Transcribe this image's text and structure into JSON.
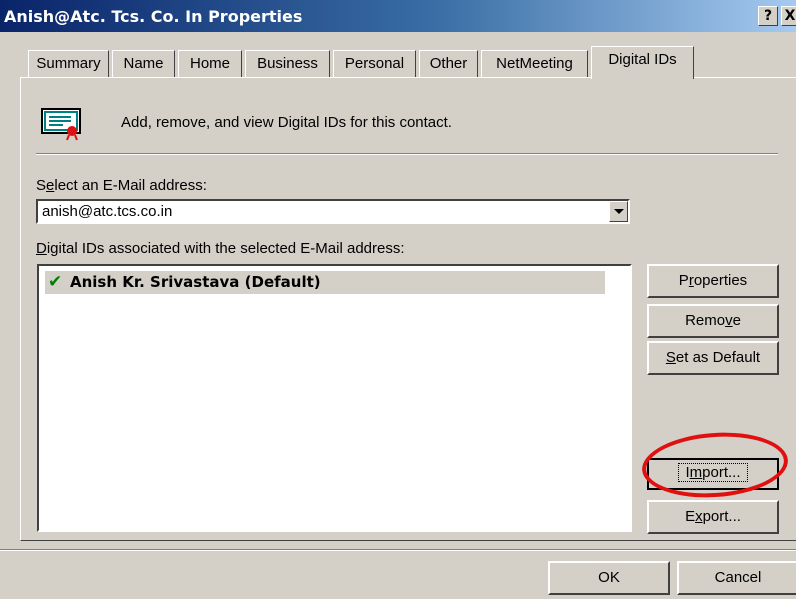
{
  "window": {
    "title": "Anish@Atc. Tcs. Co. In Properties",
    "help_label": "?",
    "close_label": "X"
  },
  "tabs": [
    "Summary",
    "Name",
    "Home",
    "Business",
    "Personal",
    "Other",
    "NetMeeting",
    "Digital IDs"
  ],
  "active_tab": "Digital IDs",
  "header": {
    "icon": "certificate-icon",
    "description": "Add, remove, and view Digital IDs for this contact."
  },
  "email_select": {
    "label_before": "S",
    "label_hotkey": "e",
    "label_after": "lect an E-Mail address:",
    "value": "anish@atc.tcs.co.in"
  },
  "ids_list": {
    "label_hotkey": "D",
    "label_after": "igital IDs associated with the selected E-Mail address:",
    "items": [
      {
        "icon": "check-icon",
        "text": "Anish Kr. Srivastava  (Default)"
      }
    ]
  },
  "buttons": {
    "properties": {
      "before": "P",
      "hotkey": "r",
      "after": "operties"
    },
    "remove": {
      "before": "Remo",
      "hotkey": "v",
      "after": "e"
    },
    "set_default": {
      "before": "",
      "hotkey": "S",
      "after": "et as Default"
    },
    "import": {
      "before": "I",
      "hotkey": "m",
      "after": "port..."
    },
    "export": {
      "before": "E",
      "hotkey": "x",
      "after": "port..."
    },
    "ok": "OK",
    "cancel": "Cancel"
  },
  "colors": {
    "face": "#d4d0c8",
    "title_start": "#0a246a",
    "title_end": "#a6caf0",
    "highlight_oval": "#e01010",
    "check": "#008000"
  }
}
